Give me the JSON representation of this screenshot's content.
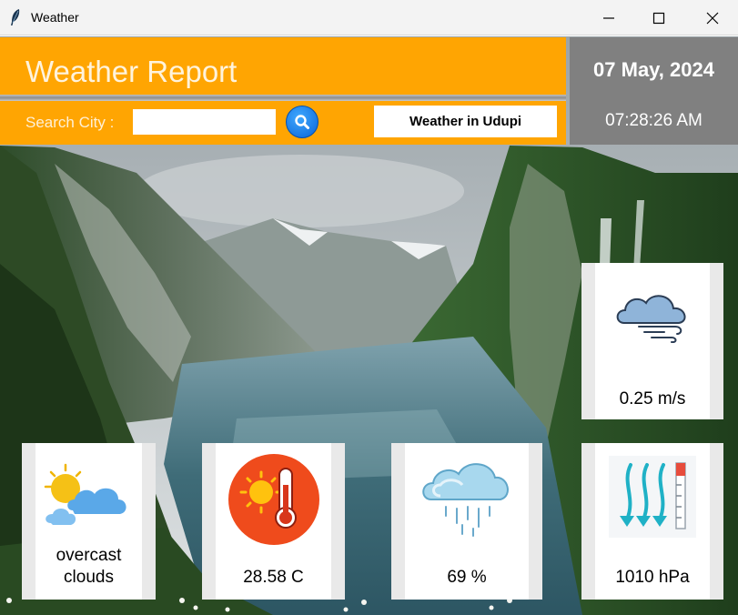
{
  "window": {
    "title": "Weather",
    "icon": "feather-icon"
  },
  "header": {
    "title": "Weather Report",
    "color": "#ffa502"
  },
  "search": {
    "label": "Search City :",
    "value": "",
    "button_icon": "search-icon",
    "result_label": "Weather in Udupi"
  },
  "datetime": {
    "date": "07 May, 2024",
    "time": "07:28:26 AM"
  },
  "cards": {
    "wind": {
      "icon": "wind-cloud-icon",
      "value": "0.25 m/s"
    },
    "description": {
      "icon": "sun-cloud-icon",
      "line1": "overcast",
      "line2": "clouds"
    },
    "temperature": {
      "icon": "thermometer-sun-icon",
      "value": "28.58 C"
    },
    "humidity": {
      "icon": "rain-cloud-icon",
      "value": "69 %"
    },
    "pressure": {
      "icon": "pressure-gauge-icon",
      "value": "1010 hPa"
    }
  }
}
